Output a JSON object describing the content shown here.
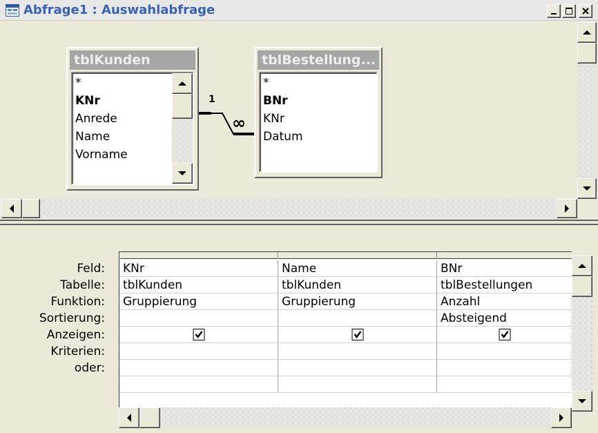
{
  "window": {
    "title": "Abfrage1 : Auswahlabfrage",
    "icon": "query-icon",
    "buttons": [
      "minimize-icon",
      "maximize-icon",
      "close-icon"
    ]
  },
  "tables": [
    {
      "name": "tblKunden",
      "fields": [
        "*",
        "KNr",
        "Anrede",
        "Name",
        "Vorname"
      ],
      "key_field": "KNr"
    },
    {
      "name": "tblBestellung...",
      "fields": [
        "*",
        "BNr",
        "KNr",
        "Datum"
      ],
      "key_field": "BNr"
    }
  ],
  "relationship": {
    "one_label": "1",
    "many_label": "∞"
  },
  "grid": {
    "row_labels": [
      "Feld:",
      "Tabelle:",
      "Funktion:",
      "Sortierung:",
      "Anzeigen:",
      "Kriterien:",
      "oder:"
    ],
    "columns": [
      {
        "feld": "KNr",
        "tabelle": "tblKunden",
        "funktion": "Gruppierung",
        "sortierung": "",
        "anzeigen": true
      },
      {
        "feld": "Name",
        "tabelle": "tblKunden",
        "funktion": "Gruppierung",
        "sortierung": "",
        "anzeigen": true
      },
      {
        "feld": "BNr",
        "tabelle": "tblBestellungen",
        "funktion": "Anzahl",
        "sortierung": "Absteigend",
        "anzeigen": true
      }
    ]
  },
  "colors": {
    "title_text": "#3a62b3",
    "table_title_bg": "#a6a6a6",
    "window_bg": "#ece9d8"
  }
}
